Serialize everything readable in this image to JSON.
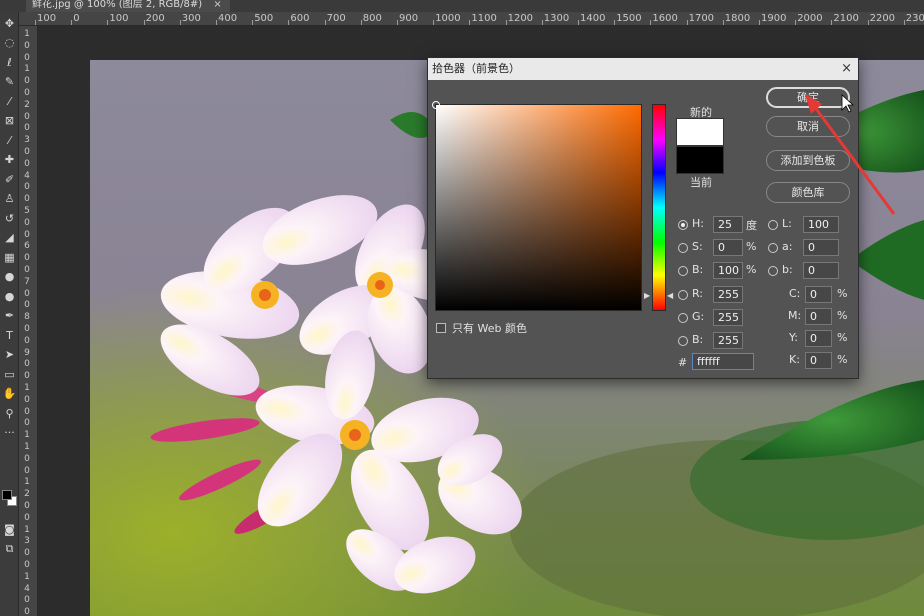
{
  "doc_tab": {
    "title": "鲜花.jpg @ 100% (图层 2, RGB/8#)",
    "close": "×"
  },
  "toolbar": {
    "tools": [
      {
        "name": "move-tool",
        "glyph": "✥"
      },
      {
        "name": "marquee-tool",
        "glyph": "◌"
      },
      {
        "name": "lasso-tool",
        "glyph": "ℓ"
      },
      {
        "name": "quick-select-tool",
        "glyph": "✎"
      },
      {
        "name": "magic-wand-tool",
        "glyph": "⁄"
      },
      {
        "name": "crop-tool",
        "glyph": "⊠"
      },
      {
        "name": "eyedropper-tool",
        "glyph": "⁄"
      },
      {
        "name": "spot-healing-tool",
        "glyph": "✚"
      },
      {
        "name": "brush-tool",
        "glyph": "✐"
      },
      {
        "name": "clone-stamp-tool",
        "glyph": "♙"
      },
      {
        "name": "history-brush-tool",
        "glyph": "↺"
      },
      {
        "name": "eraser-tool",
        "glyph": "◢"
      },
      {
        "name": "gradient-tool",
        "glyph": "▦"
      },
      {
        "name": "blur-tool",
        "glyph": "●"
      },
      {
        "name": "dodge-tool",
        "glyph": "●"
      },
      {
        "name": "pen-tool",
        "glyph": "✒"
      },
      {
        "name": "type-tool",
        "glyph": "T"
      },
      {
        "name": "path-select-tool",
        "glyph": "➤"
      },
      {
        "name": "shape-tool",
        "glyph": "▭"
      },
      {
        "name": "hand-tool",
        "glyph": "✋"
      },
      {
        "name": "zoom-tool",
        "glyph": "⚲"
      },
      {
        "name": "more-tools",
        "glyph": "···"
      }
    ],
    "foreground": "#000000",
    "background": "#ffffff"
  },
  "ruler_top": {
    "labels": [
      "100",
      "0",
      "100",
      "200",
      "300",
      "400",
      "500",
      "600",
      "700",
      "800",
      "900",
      "1000",
      "1100",
      "1200",
      "1300",
      "1400",
      "1500",
      "1600",
      "1700",
      "1800",
      "1900",
      "2000",
      "2100",
      "2200",
      "2300"
    ]
  },
  "ruler_left": {
    "labels": [
      "1",
      "0",
      "0",
      "1",
      "0",
      "0",
      "2",
      "0",
      "0",
      "3",
      "0",
      "0",
      "4",
      "0",
      "0",
      "5",
      "0",
      "0",
      "6",
      "0",
      "0",
      "7",
      "0",
      "0",
      "8",
      "0",
      "0",
      "9",
      "0",
      "0",
      "1",
      "0",
      "0",
      "0",
      "1",
      "1",
      "0",
      "0",
      "1",
      "2",
      "0",
      "0",
      "1",
      "3",
      "0",
      "0",
      "1",
      "4",
      "0",
      "0"
    ]
  },
  "dialog": {
    "title": "拾色器（前景色）",
    "close": "×",
    "new_label": "新的",
    "current_label": "当前",
    "new_color": "#ffffff",
    "current_color": "#000000",
    "web_only_label": "只有 Web 颜色",
    "buttons": {
      "ok": "确定",
      "cancel": "取消",
      "add_swatch": "添加到色板",
      "color_library": "颜色库"
    },
    "hsb": [
      {
        "label": "H:",
        "value": "25",
        "unit": "度",
        "selected": true
      },
      {
        "label": "S:",
        "value": "0",
        "unit": "%",
        "selected": false
      },
      {
        "label": "B:",
        "value": "100",
        "unit": "%",
        "selected": false
      }
    ],
    "rgb": [
      {
        "label": "R:",
        "value": "255",
        "selected": false
      },
      {
        "label": "G:",
        "value": "255",
        "selected": false
      },
      {
        "label": "B:",
        "value": "255",
        "selected": false
      }
    ],
    "lab": [
      {
        "label": "L:",
        "value": "100",
        "selected": false
      },
      {
        "label": "a:",
        "value": "0",
        "selected": false
      },
      {
        "label": "b:",
        "value": "0",
        "selected": false
      }
    ],
    "cmyk": [
      {
        "label": "C:",
        "value": "0",
        "unit": "%"
      },
      {
        "label": "M:",
        "value": "0",
        "unit": "%"
      },
      {
        "label": "Y:",
        "value": "0",
        "unit": "%"
      },
      {
        "label": "K:",
        "value": "0",
        "unit": "%"
      }
    ],
    "hex_label": "#",
    "hex_value": "ffffff"
  },
  "colors": {
    "accent_arrow": "#e53935"
  }
}
